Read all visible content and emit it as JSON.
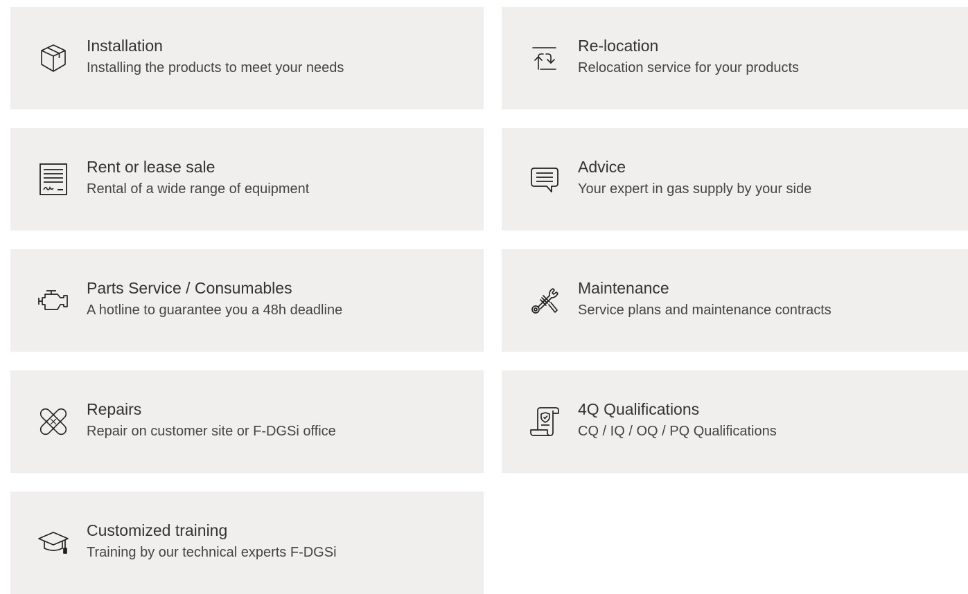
{
  "services": [
    {
      "icon": "box-icon",
      "title": "Installation",
      "description": "Installing the products to meet your needs"
    },
    {
      "icon": "relocation-arrows-icon",
      "title": "Re-location",
      "description": "Relocation service for your products"
    },
    {
      "icon": "contract-document-icon",
      "title": "Rent or lease sale",
      "description": "Rental of a wide range of equipment"
    },
    {
      "icon": "chat-bubble-icon",
      "title": "Advice",
      "description": "Your expert in gas supply by your side"
    },
    {
      "icon": "engine-icon",
      "title": "Parts Service / Consumables",
      "description": "A hotline to guarantee you a 48h deadline"
    },
    {
      "icon": "tools-icon",
      "title": "Maintenance",
      "description": "Service plans and maintenance contracts"
    },
    {
      "icon": "bandage-icon",
      "title": "Repairs",
      "description": "Repair on customer site or F-DGSi office"
    },
    {
      "icon": "certificate-scroll-icon",
      "title": "4Q Qualifications",
      "description": "CQ / IQ / OQ / PQ Qualifications"
    },
    {
      "icon": "graduation-cap-icon",
      "title": "Customized training",
      "description": "Training by our technical experts F-DGSi"
    }
  ],
  "colors": {
    "card_background": "#f0efee",
    "text": "#333333",
    "icon_stroke": "#222222"
  }
}
